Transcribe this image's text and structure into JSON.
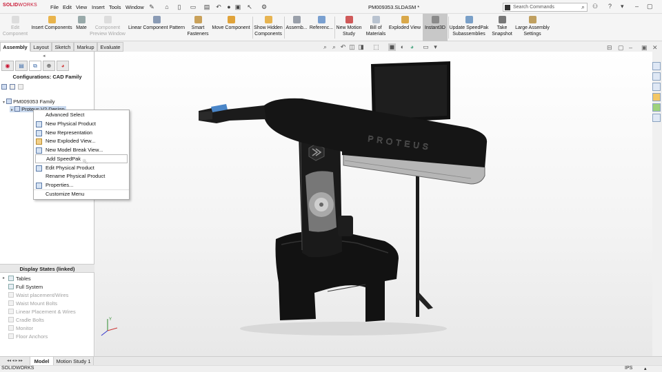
{
  "app": {
    "logo_bold": "SOLID",
    "logo_thin": "WORKS",
    "document_title": "PM009353.SLDASM *"
  },
  "menu": [
    "File",
    "Edit",
    "View",
    "Insert",
    "Tools",
    "Window"
  ],
  "search": {
    "placeholder": "Search Commands"
  },
  "commands": [
    {
      "label": "Edit Component",
      "disabled": true
    },
    {
      "label": "Insert Components"
    },
    {
      "label": "Mate"
    },
    {
      "label": "Component Preview Window",
      "disabled": true
    },
    {
      "label": "Linear Component Pattern"
    },
    {
      "label": "Smart Fasteners"
    },
    {
      "label": "Move Component"
    },
    {
      "label": "Show Hidden Components"
    },
    {
      "label": "Assemb..."
    },
    {
      "label": "Referenc..."
    },
    {
      "label": "New Motion Study"
    },
    {
      "label": "Bill of Materials"
    },
    {
      "label": "Exploded View"
    },
    {
      "label": "Instant3D",
      "active": true
    },
    {
      "label": "Update SpeedPak Subassemblies"
    },
    {
      "label": "Take Snapshot"
    },
    {
      "label": "Large Assembly Settings"
    }
  ],
  "tabs": [
    "Assembly",
    "Layout",
    "Sketch",
    "Markup",
    "Evaluate"
  ],
  "active_tab": "Assembly",
  "config_panel": {
    "title": "Configurations: CAD Family",
    "root": "PM009353 Family",
    "child": "Proteus V2 Design"
  },
  "context_menu": [
    {
      "label": "Advanced Select",
      "icon": false
    },
    {
      "label": "New Physical Product",
      "icon": true
    },
    {
      "label": "New Representation",
      "icon": true
    },
    {
      "label": "New Exploded View...",
      "icon": true
    },
    {
      "label": "New Model Break View...",
      "icon": true
    },
    {
      "label": "Add SpeedPak",
      "icon": false,
      "highlighted": true
    },
    {
      "label": "Edit Physical Product",
      "icon": true
    },
    {
      "label": "Rename Physical Product",
      "icon": false
    },
    {
      "label": "Properties...",
      "icon": true
    },
    {
      "label": "Customize Menu",
      "icon": false
    }
  ],
  "display_states": {
    "header": "Display States (linked)",
    "items": [
      {
        "label": "Tables",
        "dim": false,
        "expander": true
      },
      {
        "label": "Full System",
        "dim": false
      },
      {
        "label": "Waist placement/Wires",
        "dim": true
      },
      {
        "label": "Waist Mount Bolts",
        "dim": true
      },
      {
        "label": "Linear Placement & Wires",
        "dim": true
      },
      {
        "label": "Cradle Bolts",
        "dim": true
      },
      {
        "label": "Monitor",
        "dim": true
      },
      {
        "label": "Floor Anchors",
        "dim": true
      }
    ]
  },
  "model": {
    "brand_text": "PROTEUS",
    "axis_label": "Y"
  },
  "bottom_tabs": [
    "Model",
    "Motion Study 1"
  ],
  "active_bottom_tab": "Model",
  "status": {
    "left": "SOLIDWORKS",
    "units": "IPS"
  }
}
